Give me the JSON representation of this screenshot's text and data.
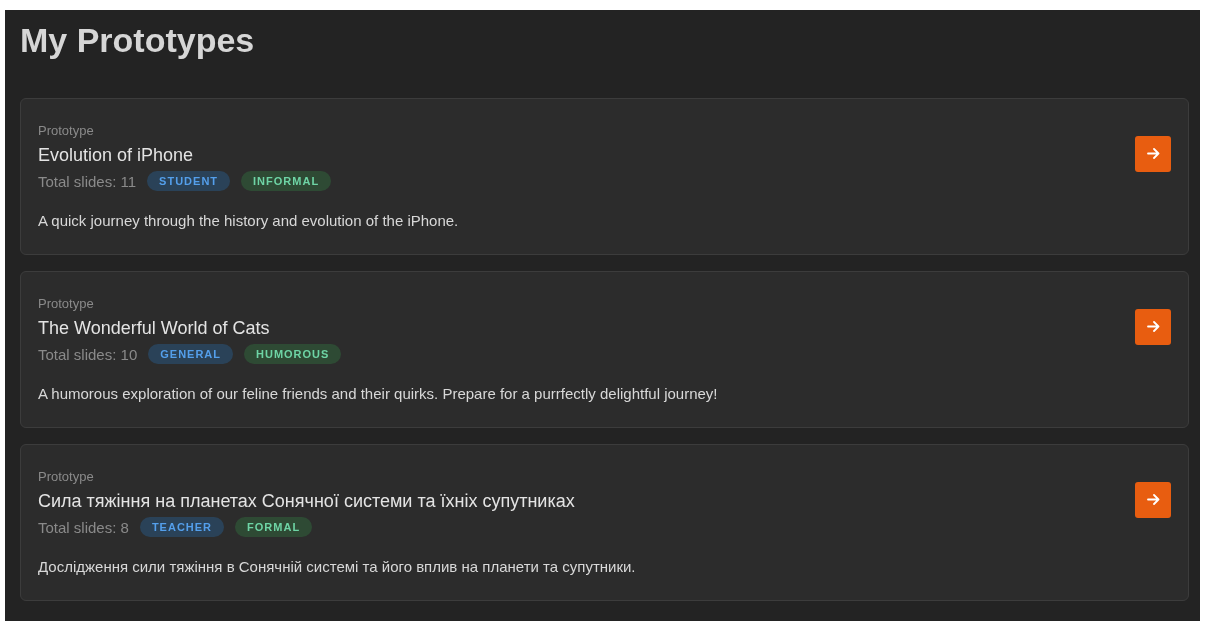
{
  "page": {
    "title": "My Prototypes"
  },
  "prototypes": [
    {
      "label": "Prototype",
      "title": "Evolution of iPhone",
      "slides": "Total slides: 11",
      "tags": [
        {
          "text": "STUDENT",
          "color": "#2a4258"
        },
        {
          "text": "INFORMAL",
          "color": "#2e4a34"
        }
      ],
      "description": "A quick journey through the history and evolution of the iPhone."
    },
    {
      "label": "Prototype",
      "title": "The Wonderful World of Cats",
      "slides": "Total slides: 10",
      "tags": [
        {
          "text": "GENERAL",
          "color": "#2a4258"
        },
        {
          "text": "HUMOROUS",
          "color": "#2e4a34"
        }
      ],
      "description": "A humorous exploration of our feline friends and their quirks. Prepare for a purrfectly delightful journey!"
    },
    {
      "label": "Prototype",
      "title": "Сила тяжіння на планетах Сонячної системи та їхніх супутниках",
      "slides": "Total slides: 8",
      "tags": [
        {
          "text": "TEACHER",
          "color": "#2a4258"
        },
        {
          "text": "FORMAL",
          "color": "#2e4a34"
        }
      ],
      "description": "Дослідження сили тяжіння в Сонячній системі та його вплив на планети та супутники."
    }
  ]
}
